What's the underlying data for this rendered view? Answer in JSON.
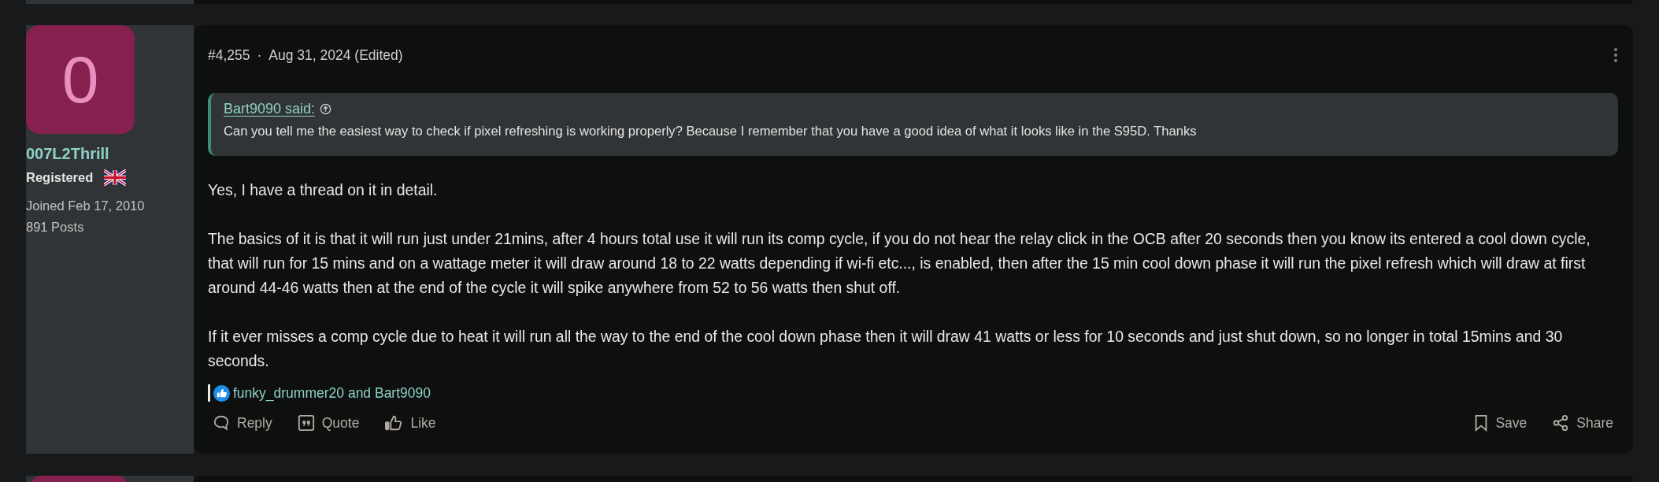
{
  "author": {
    "avatar_letter": "0",
    "name": "007L2Thrill",
    "role": "Registered",
    "joined": "Joined Feb 17, 2010",
    "posts": "891 Posts"
  },
  "post": {
    "number": "#4,255",
    "separator": "·",
    "date": "Aug 31, 2024 (Edited)"
  },
  "quote": {
    "source": "Bart9090 said:",
    "text": "Can you tell me the easiest way to check if pixel refreshing is working properly? Because I remember that you have a good idea of what it looks like in the S95D. Thanks"
  },
  "body": [
    "Yes, I have a thread on it in detail.",
    "The basics of it is that it will run just under 21mins, after 4 hours total use it will run its comp cycle, if you do not hear the relay click in the OCB after 20 seconds then you know its entered a cool down cycle, that will run for 15 mins and on a wattage meter it will draw around 18 to 22 watts depending if wi-fi etc..., is enabled, then after the 15 min cool down phase it will run the pixel refresh which will draw at first around 44-46 watts then at the end of the cycle it will spike anywhere from 52 to 56 watts then shut off.",
    "If it ever misses a comp cycle due to heat it will run all the way to the end of the cool down phase then it will draw 41 watts or less for 10 seconds and just shut down, so no longer in total 15mins and 30 seconds."
  ],
  "reactions": {
    "users": "funky_drummer20 and Bart9090"
  },
  "actions": [
    {
      "kind": "reply",
      "label": "Reply"
    },
    {
      "kind": "quote",
      "label": "Quote"
    },
    {
      "kind": "like",
      "label": "Like"
    }
  ],
  "actions_end": [
    {
      "kind": "save",
      "label": "Save"
    },
    {
      "kind": "share",
      "label": "Share"
    }
  ]
}
